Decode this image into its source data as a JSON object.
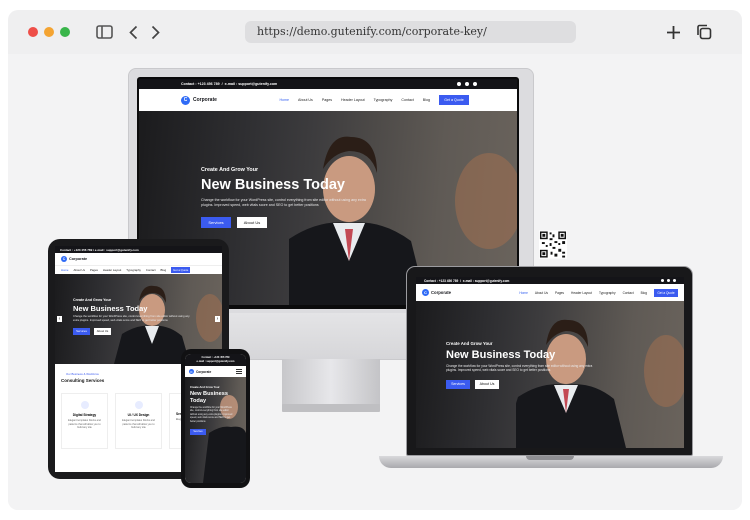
{
  "browser": {
    "url": "https://demo.gutenify.com/corporate-key/"
  },
  "site": {
    "contact": "Contact : +123 456 789",
    "email": "e-mail : support@gutenify.com",
    "contact_email_mobile": "e-mail : support@gutenify.com",
    "contact_phone_mobile": "Contact : +123 456 789",
    "logo_text": "Corporate",
    "logo_letter": "C",
    "menu": [
      "Home",
      "About Us",
      "Pages",
      "Header Layout",
      "Typography",
      "Contact",
      "Blog"
    ],
    "quote_button": "Get a Quote",
    "hero": {
      "kicker": "Create And Grow Your",
      "title": "New Business Today",
      "title_line1": "New Business",
      "title_line2": "Today",
      "description": "Change the workflow for your WordPress site, control everything from site editor without using any extra plugins. Improved speed, web vitals score and SEO to get better positions",
      "services_button": "Services",
      "about_button": "About Us"
    },
    "services_section": {
      "kicker": "Our Business & Workforce",
      "title": "Consulting Services",
      "cards": [
        {
          "title": "Digital Strategy",
          "text": "Elegant templates blocks and patterns that will allow you to build any site"
        },
        {
          "title": "UI / UX Design",
          "text": "Elegant templates blocks and patterns that will allow you to build any site"
        },
        {
          "title": "Ser",
          "text": "Elegant"
        }
      ]
    }
  },
  "colors": {
    "accent": "#3b5bf0",
    "topbar": "#141418",
    "traffic_red": "#ee4e48",
    "traffic_yellow": "#f4a432",
    "traffic_green": "#39b54a"
  },
  "icons": [
    "sidebar-icon",
    "chevron-left-icon",
    "chevron-right-icon",
    "plus-icon",
    "tabs-icon",
    "qr-code-icon"
  ]
}
